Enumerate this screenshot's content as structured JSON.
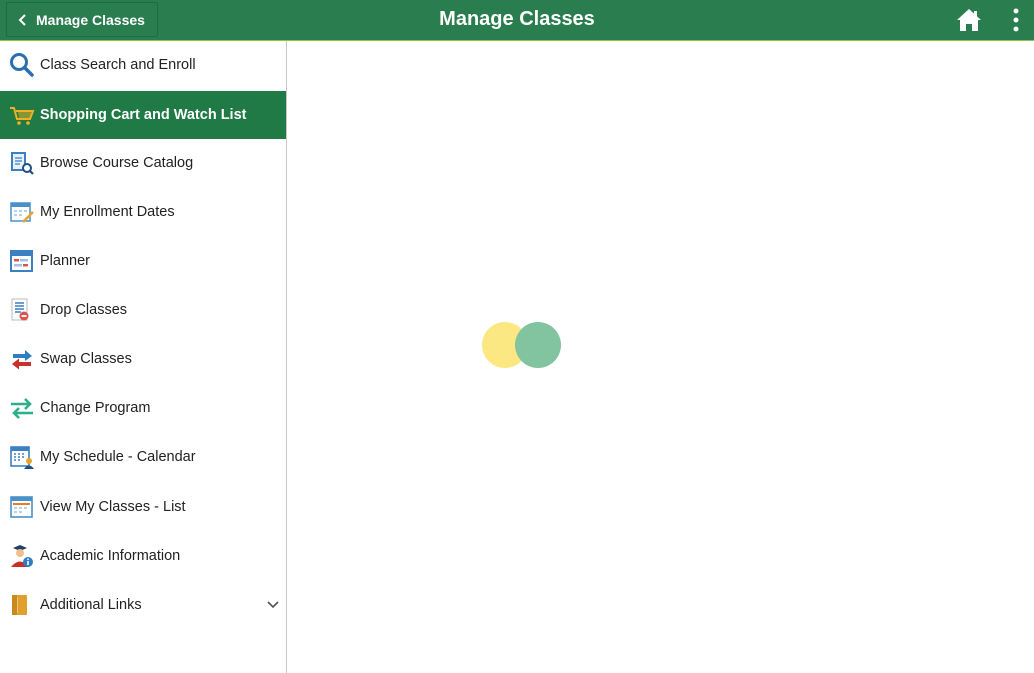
{
  "header": {
    "back_label": "Manage Classes",
    "title": "Manage Classes",
    "home_icon": "home-icon",
    "more_icon": "more-vertical-icon"
  },
  "sidebar": {
    "items": [
      {
        "label": "Class Search and Enroll",
        "icon": "search-icon"
      },
      {
        "label": "Shopping Cart and Watch List",
        "icon": "shopping-cart-icon",
        "active": true
      },
      {
        "label": "Browse Course Catalog",
        "icon": "catalog-icon"
      },
      {
        "label": "My Enrollment Dates",
        "icon": "calendar-edit-icon"
      },
      {
        "label": "Planner",
        "icon": "planner-icon"
      },
      {
        "label": "Drop Classes",
        "icon": "drop-list-icon"
      },
      {
        "label": "Swap Classes",
        "icon": "swap-arrows-icon"
      },
      {
        "label": "Change Program",
        "icon": "change-arrows-icon"
      },
      {
        "label": "My Schedule - Calendar",
        "icon": "schedule-calendar-icon"
      },
      {
        "label": "View My Classes - List",
        "icon": "calendar-list-icon"
      },
      {
        "label": "Academic Information",
        "icon": "graduate-info-icon"
      },
      {
        "label": "Additional Links",
        "icon": "folder-icon",
        "expandable": true
      }
    ]
  },
  "colors": {
    "header_bg": "#2a7d4f",
    "active_bg": "#1f7a45",
    "spinner_yellow": "#fbe882",
    "spinner_green": "#82c3a0"
  }
}
